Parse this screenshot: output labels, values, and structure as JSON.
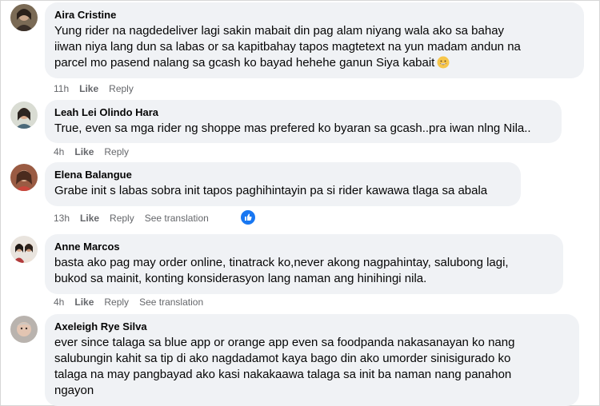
{
  "comments": [
    {
      "author": "Aira Cristine",
      "lines": [
        "Yung rider na nagdedeliver lagi sakin mabait din pag alam niyang wala ako sa bahay",
        "iiwan niya lang dun sa labas or sa kapitbahay tapos magtetext na yun madam andun na",
        "parcel mo pasend nalang sa gcash ko bayad hehehe ganun Siya kabait"
      ],
      "emoji": "grinning-face-emoji",
      "time": "11h",
      "like": "Like",
      "reply": "Reply"
    },
    {
      "author": "Leah Lei Olindo Hara",
      "lines": [
        "True, even sa mga rider ng shoppe mas prefered ko byaran sa gcash..pra iwan nlng Nila.."
      ],
      "time": "4h",
      "like": "Like",
      "reply": "Reply"
    },
    {
      "author": "Elena Balangue",
      "lines": [
        "Grabe init s labas sobra init tapos paghihintayin pa si rider kawawa tlaga sa abala"
      ],
      "time": "13h",
      "like": "Like",
      "reply": "Reply",
      "see_translation": "See translation",
      "reaction": "like-reaction"
    },
    {
      "author": "Anne Marcos",
      "lines": [
        "basta ako pag may order online, tinatrack ko,never akong nagpahintay, salubong lagi,",
        "bukod sa mainit, konting konsiderasyon lang naman ang hinihingi nila."
      ],
      "time": "4h",
      "like": "Like",
      "reply": "Reply",
      "see_translation": "See translation"
    },
    {
      "author": "Axeleigh Rye Silva",
      "lines": [
        "ever since talaga sa blue app or orange app even sa foodpanda nakasanayan ko nang",
        "salubungin kahit sa tip di ako nagdadamot kaya bago din ako umorder sinisigurado ko",
        "talaga na may pangbayad ako kasi nakakaawa talaga sa init ba naman nang panahon",
        "ngayon"
      ]
    }
  ],
  "colors": {
    "bubble": "#f0f2f5",
    "meta": "#65676b",
    "like_blue": "#1877f2"
  }
}
